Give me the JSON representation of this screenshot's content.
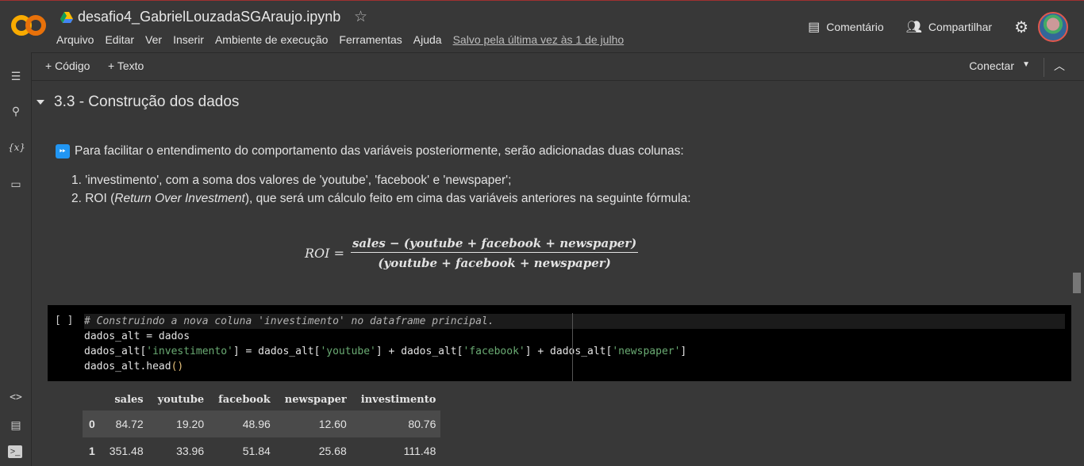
{
  "header": {
    "doc_title": "desafio4_GabrielLouzadaSGAraujo.ipynb",
    "menu": [
      "Arquivo",
      "Editar",
      "Ver",
      "Inserir",
      "Ambiente de execução",
      "Ferramentas",
      "Ajuda"
    ],
    "saved_text": "Salvo pela última vez às 1 de julho",
    "comment_label": "Comentário",
    "share_label": "Compartilhar"
  },
  "toolbar": {
    "code_label": "+ Código",
    "text_label": "+ Texto",
    "connect_label": "Conectar"
  },
  "section": {
    "title": "3.3 - Construção dos dados"
  },
  "text_cell": {
    "intro": "Para facilitar o entendimento do comportamento das variáveis posteriormente, serão adicionadas duas colunas:",
    "item1": "1. 'investimento', com a soma dos valores de 'youtube', 'facebook' e 'newspaper';",
    "item2_pre": "2. ROI (",
    "item2_em": "Return Over Investment",
    "item2_post": "), que será um cálculo feito em cima das variáveis anteriores na seguinte fórmula:",
    "formula_lhs": "ROI =",
    "formula_num": "sales − (youtube + facebook + newspaper)",
    "formula_den": "(youtube + facebook + newspaper)"
  },
  "code_cell": {
    "bracket": "[ ]",
    "comment": "# Construindo a nova coluna 'investimento' no dataframe principal.",
    "line2": "dados_alt = dados",
    "line3_a": "dados_alt[",
    "line3_s1": "'investimento'",
    "line3_b": "] = dados_alt[",
    "line3_s2": "'youtube'",
    "line3_c": "] + dados_alt[",
    "line3_s3": "'facebook'",
    "line3_d": "] + dados_alt[",
    "line3_s4": "'newspaper'",
    "line3_e": "]",
    "line4_a": "dados_alt.head",
    "line4_p": "()"
  },
  "dataframe": {
    "columns": [
      "",
      "sales",
      "youtube",
      "facebook",
      "newspaper",
      "investimento"
    ],
    "rows": [
      [
        "0",
        "84.72",
        "19.20",
        "48.96",
        "12.60",
        "80.76"
      ],
      [
        "1",
        "351.48",
        "33.96",
        "51.84",
        "25.68",
        "111.48"
      ]
    ]
  }
}
